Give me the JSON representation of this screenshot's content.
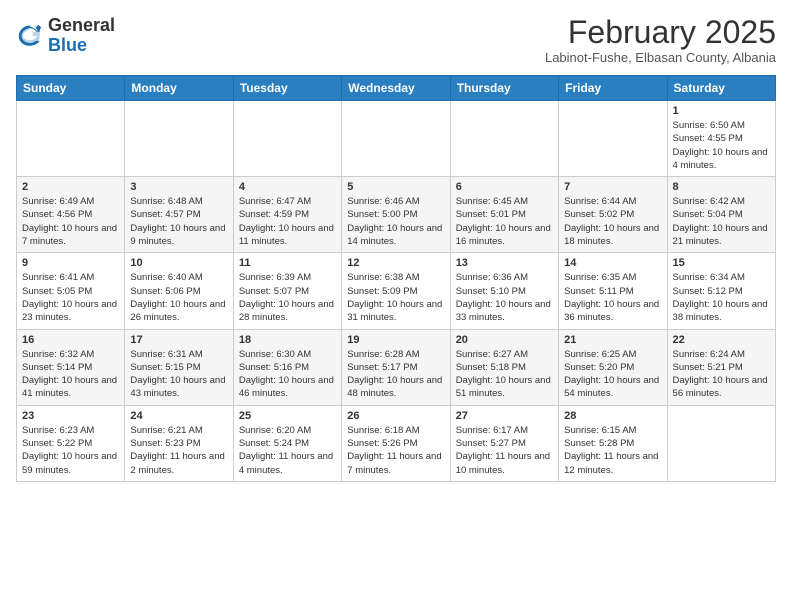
{
  "header": {
    "logo_general": "General",
    "logo_blue": "Blue",
    "month_title": "February 2025",
    "location": "Labinot-Fushe, Elbasan County, Albania"
  },
  "weekdays": [
    "Sunday",
    "Monday",
    "Tuesday",
    "Wednesday",
    "Thursday",
    "Friday",
    "Saturday"
  ],
  "weeks": [
    [
      {
        "day": "",
        "info": ""
      },
      {
        "day": "",
        "info": ""
      },
      {
        "day": "",
        "info": ""
      },
      {
        "day": "",
        "info": ""
      },
      {
        "day": "",
        "info": ""
      },
      {
        "day": "",
        "info": ""
      },
      {
        "day": "1",
        "info": "Sunrise: 6:50 AM\nSunset: 4:55 PM\nDaylight: 10 hours and 4 minutes."
      }
    ],
    [
      {
        "day": "2",
        "info": "Sunrise: 6:49 AM\nSunset: 4:56 PM\nDaylight: 10 hours and 7 minutes."
      },
      {
        "day": "3",
        "info": "Sunrise: 6:48 AM\nSunset: 4:57 PM\nDaylight: 10 hours and 9 minutes."
      },
      {
        "day": "4",
        "info": "Sunrise: 6:47 AM\nSunset: 4:59 PM\nDaylight: 10 hours and 11 minutes."
      },
      {
        "day": "5",
        "info": "Sunrise: 6:46 AM\nSunset: 5:00 PM\nDaylight: 10 hours and 14 minutes."
      },
      {
        "day": "6",
        "info": "Sunrise: 6:45 AM\nSunset: 5:01 PM\nDaylight: 10 hours and 16 minutes."
      },
      {
        "day": "7",
        "info": "Sunrise: 6:44 AM\nSunset: 5:02 PM\nDaylight: 10 hours and 18 minutes."
      },
      {
        "day": "8",
        "info": "Sunrise: 6:42 AM\nSunset: 5:04 PM\nDaylight: 10 hours and 21 minutes."
      }
    ],
    [
      {
        "day": "9",
        "info": "Sunrise: 6:41 AM\nSunset: 5:05 PM\nDaylight: 10 hours and 23 minutes."
      },
      {
        "day": "10",
        "info": "Sunrise: 6:40 AM\nSunset: 5:06 PM\nDaylight: 10 hours and 26 minutes."
      },
      {
        "day": "11",
        "info": "Sunrise: 6:39 AM\nSunset: 5:07 PM\nDaylight: 10 hours and 28 minutes."
      },
      {
        "day": "12",
        "info": "Sunrise: 6:38 AM\nSunset: 5:09 PM\nDaylight: 10 hours and 31 minutes."
      },
      {
        "day": "13",
        "info": "Sunrise: 6:36 AM\nSunset: 5:10 PM\nDaylight: 10 hours and 33 minutes."
      },
      {
        "day": "14",
        "info": "Sunrise: 6:35 AM\nSunset: 5:11 PM\nDaylight: 10 hours and 36 minutes."
      },
      {
        "day": "15",
        "info": "Sunrise: 6:34 AM\nSunset: 5:12 PM\nDaylight: 10 hours and 38 minutes."
      }
    ],
    [
      {
        "day": "16",
        "info": "Sunrise: 6:32 AM\nSunset: 5:14 PM\nDaylight: 10 hours and 41 minutes."
      },
      {
        "day": "17",
        "info": "Sunrise: 6:31 AM\nSunset: 5:15 PM\nDaylight: 10 hours and 43 minutes."
      },
      {
        "day": "18",
        "info": "Sunrise: 6:30 AM\nSunset: 5:16 PM\nDaylight: 10 hours and 46 minutes."
      },
      {
        "day": "19",
        "info": "Sunrise: 6:28 AM\nSunset: 5:17 PM\nDaylight: 10 hours and 48 minutes."
      },
      {
        "day": "20",
        "info": "Sunrise: 6:27 AM\nSunset: 5:18 PM\nDaylight: 10 hours and 51 minutes."
      },
      {
        "day": "21",
        "info": "Sunrise: 6:25 AM\nSunset: 5:20 PM\nDaylight: 10 hours and 54 minutes."
      },
      {
        "day": "22",
        "info": "Sunrise: 6:24 AM\nSunset: 5:21 PM\nDaylight: 10 hours and 56 minutes."
      }
    ],
    [
      {
        "day": "23",
        "info": "Sunrise: 6:23 AM\nSunset: 5:22 PM\nDaylight: 10 hours and 59 minutes."
      },
      {
        "day": "24",
        "info": "Sunrise: 6:21 AM\nSunset: 5:23 PM\nDaylight: 11 hours and 2 minutes."
      },
      {
        "day": "25",
        "info": "Sunrise: 6:20 AM\nSunset: 5:24 PM\nDaylight: 11 hours and 4 minutes."
      },
      {
        "day": "26",
        "info": "Sunrise: 6:18 AM\nSunset: 5:26 PM\nDaylight: 11 hours and 7 minutes."
      },
      {
        "day": "27",
        "info": "Sunrise: 6:17 AM\nSunset: 5:27 PM\nDaylight: 11 hours and 10 minutes."
      },
      {
        "day": "28",
        "info": "Sunrise: 6:15 AM\nSunset: 5:28 PM\nDaylight: 11 hours and 12 minutes."
      },
      {
        "day": "",
        "info": ""
      }
    ]
  ]
}
